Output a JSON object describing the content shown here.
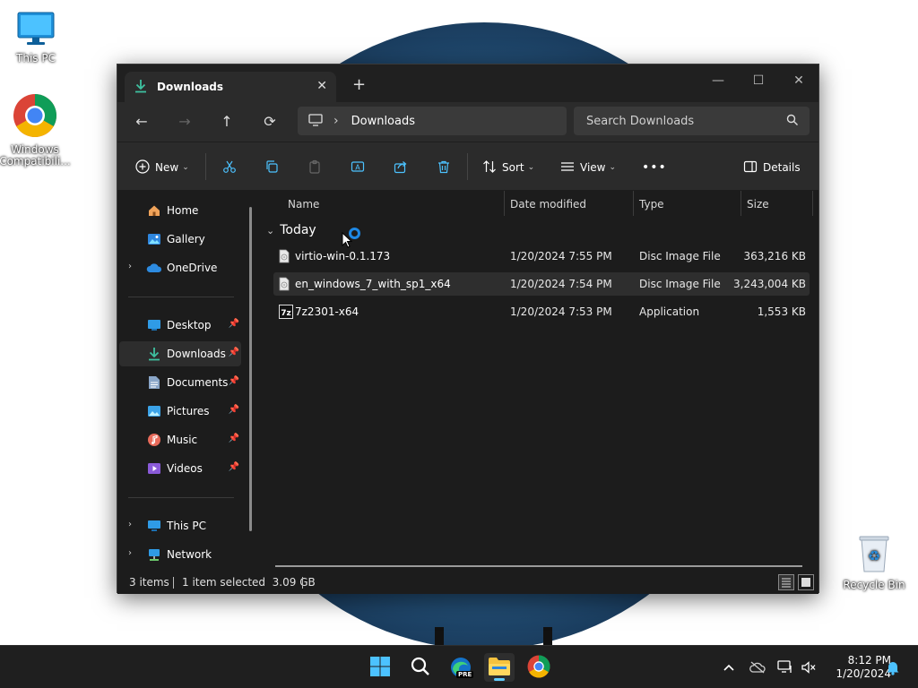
{
  "desktop": {
    "icons": [
      {
        "label": "This PC"
      },
      {
        "label": "Windows Compatibili..."
      },
      {
        "label": "Recycle Bin"
      }
    ]
  },
  "window": {
    "tab_title": "Downloads",
    "new_tab_glyph": "+",
    "caption": {
      "minimize": "—",
      "maximize": "☐",
      "close": "✕"
    },
    "nav": {
      "back": "←",
      "forward": "→",
      "up": "↑",
      "refresh": "⟳"
    },
    "address": {
      "crumb": "Downloads",
      "separator": "›"
    },
    "search": {
      "placeholder": "Search Downloads"
    },
    "toolbar": {
      "new_label": "New",
      "sort_label": "Sort",
      "view_label": "View",
      "more_label": "•••",
      "details_label": "Details"
    },
    "sidebar": {
      "items": [
        {
          "label": "Home"
        },
        {
          "label": "Gallery"
        },
        {
          "label": "OneDrive"
        },
        {
          "label": "Desktop"
        },
        {
          "label": "Downloads"
        },
        {
          "label": "Documents"
        },
        {
          "label": "Pictures"
        },
        {
          "label": "Music"
        },
        {
          "label": "Videos"
        },
        {
          "label": "This PC"
        },
        {
          "label": "Network"
        }
      ]
    },
    "columns": {
      "name": "Name",
      "date": "Date modified",
      "type": "Type",
      "size": "Size"
    },
    "group": {
      "label": "Today"
    },
    "files": [
      {
        "name": "virtio-win-0.1.173",
        "date": "1/20/2024 7:55 PM",
        "type": "Disc Image File",
        "size": "363,216 KB"
      },
      {
        "name": "en_windows_7_with_sp1_x64",
        "date": "1/20/2024 7:54 PM",
        "type": "Disc Image File",
        "size": "3,243,004 KB"
      },
      {
        "name": "7z2301-x64",
        "date": "1/20/2024 7:53 PM",
        "type": "Application",
        "size": "1,553 KB"
      }
    ],
    "status": {
      "items": "3 items",
      "selected": "1 item selected  3.09 GB"
    }
  },
  "taskbar": {
    "edge_badge": "PRE",
    "clock": {
      "time": "8:12 PM",
      "date": "1/20/2024"
    }
  },
  "colors": {
    "accent": "#60cdff",
    "window_bg": "#1c1c1c",
    "toolbar_bg": "#2b2b2b"
  }
}
